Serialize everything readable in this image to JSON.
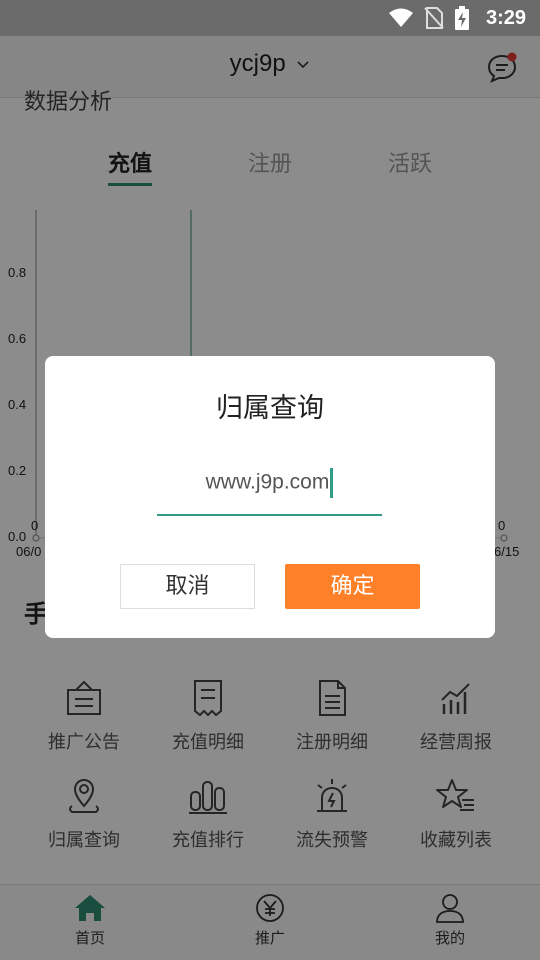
{
  "status_bar": {
    "time": "3:29"
  },
  "app_bar": {
    "title": "ycj9p"
  },
  "page": {
    "heading_cut": "数据分析",
    "tabs": [
      {
        "label": "充值",
        "active": true
      },
      {
        "label": "注册",
        "active": false
      },
      {
        "label": "活跃",
        "active": false
      }
    ],
    "section_title": "手"
  },
  "chart_data": {
    "type": "line",
    "y_ticks": [
      "0.8",
      "0.6",
      "0.4",
      "0.2",
      "0.0"
    ],
    "x_tick_labels": [
      "06/0",
      "6/15"
    ],
    "data_labels": [
      "0",
      "0"
    ],
    "ylim": [
      0,
      1
    ]
  },
  "grid": {
    "items": [
      {
        "label": "推广公告",
        "icon": "announcement-icon"
      },
      {
        "label": "充值明细",
        "icon": "receipt-icon"
      },
      {
        "label": "注册明细",
        "icon": "document-icon"
      },
      {
        "label": "经营周报",
        "icon": "bar-chart-trend-icon"
      },
      {
        "label": "归属查询",
        "icon": "location-pin-icon"
      },
      {
        "label": "充值排行",
        "icon": "ranking-bars-icon"
      },
      {
        "label": "流失预警",
        "icon": "alarm-light-icon"
      },
      {
        "label": "收藏列表",
        "icon": "star-list-icon"
      }
    ]
  },
  "bottom_nav": {
    "items": [
      {
        "label": "首页",
        "icon": "home-icon",
        "active": true
      },
      {
        "label": "推广",
        "icon": "yen-circle-icon",
        "active": false
      },
      {
        "label": "我的",
        "icon": "user-icon",
        "active": false
      }
    ]
  },
  "dialog": {
    "title": "归属查询",
    "input_value": "www.j9p.com",
    "cancel_label": "取消",
    "confirm_label": "确定"
  },
  "colors": {
    "accent_green": "#2f8c72",
    "confirm_orange": "#fe8029",
    "notification_red": "#e53935"
  }
}
